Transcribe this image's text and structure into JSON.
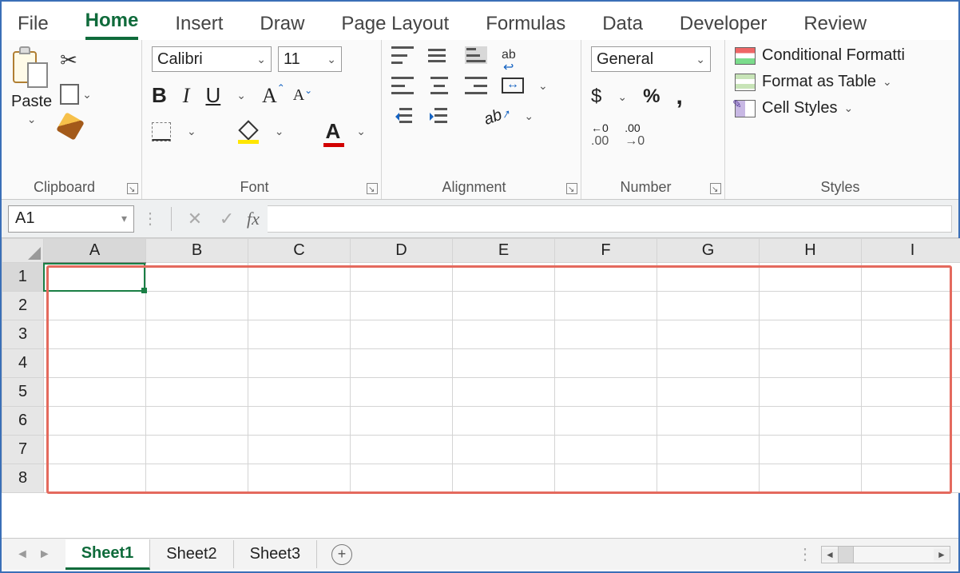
{
  "tabs": {
    "file": "File",
    "home": "Home",
    "insert": "Insert",
    "draw": "Draw",
    "page_layout": "Page Layout",
    "formulas": "Formulas",
    "data": "Data",
    "developer": "Developer",
    "review": "Review",
    "active": "Home"
  },
  "ribbon": {
    "clipboard": {
      "label": "Clipboard",
      "paste": "Paste"
    },
    "font": {
      "label": "Font",
      "name": "Calibri",
      "size": "11",
      "bold": "B",
      "italic": "I",
      "underline": "U",
      "grow": "A",
      "shrink": "A",
      "color_letter": "A"
    },
    "alignment": {
      "label": "Alignment"
    },
    "number": {
      "label": "Number",
      "format": "General",
      "currency": "$",
      "percent": "%",
      "comma": ","
    },
    "styles": {
      "label": "Styles",
      "conditional": "Conditional Formatti",
      "table": "Format as Table",
      "cell": "Cell Styles"
    }
  },
  "formula_bar": {
    "name_box": "A1",
    "cancel": "✕",
    "enter": "✓",
    "fx": "fx",
    "value": ""
  },
  "grid": {
    "columns": [
      "A",
      "B",
      "C",
      "D",
      "E",
      "F",
      "G",
      "H",
      "I"
    ],
    "rows": [
      "1",
      "2",
      "3",
      "4",
      "5",
      "6",
      "7",
      "8"
    ],
    "active_col": "A",
    "active_row": "1"
  },
  "sheet_tabs": {
    "s1": "Sheet1",
    "s2": "Sheet2",
    "s3": "Sheet3",
    "active": "Sheet1",
    "new": "+"
  }
}
